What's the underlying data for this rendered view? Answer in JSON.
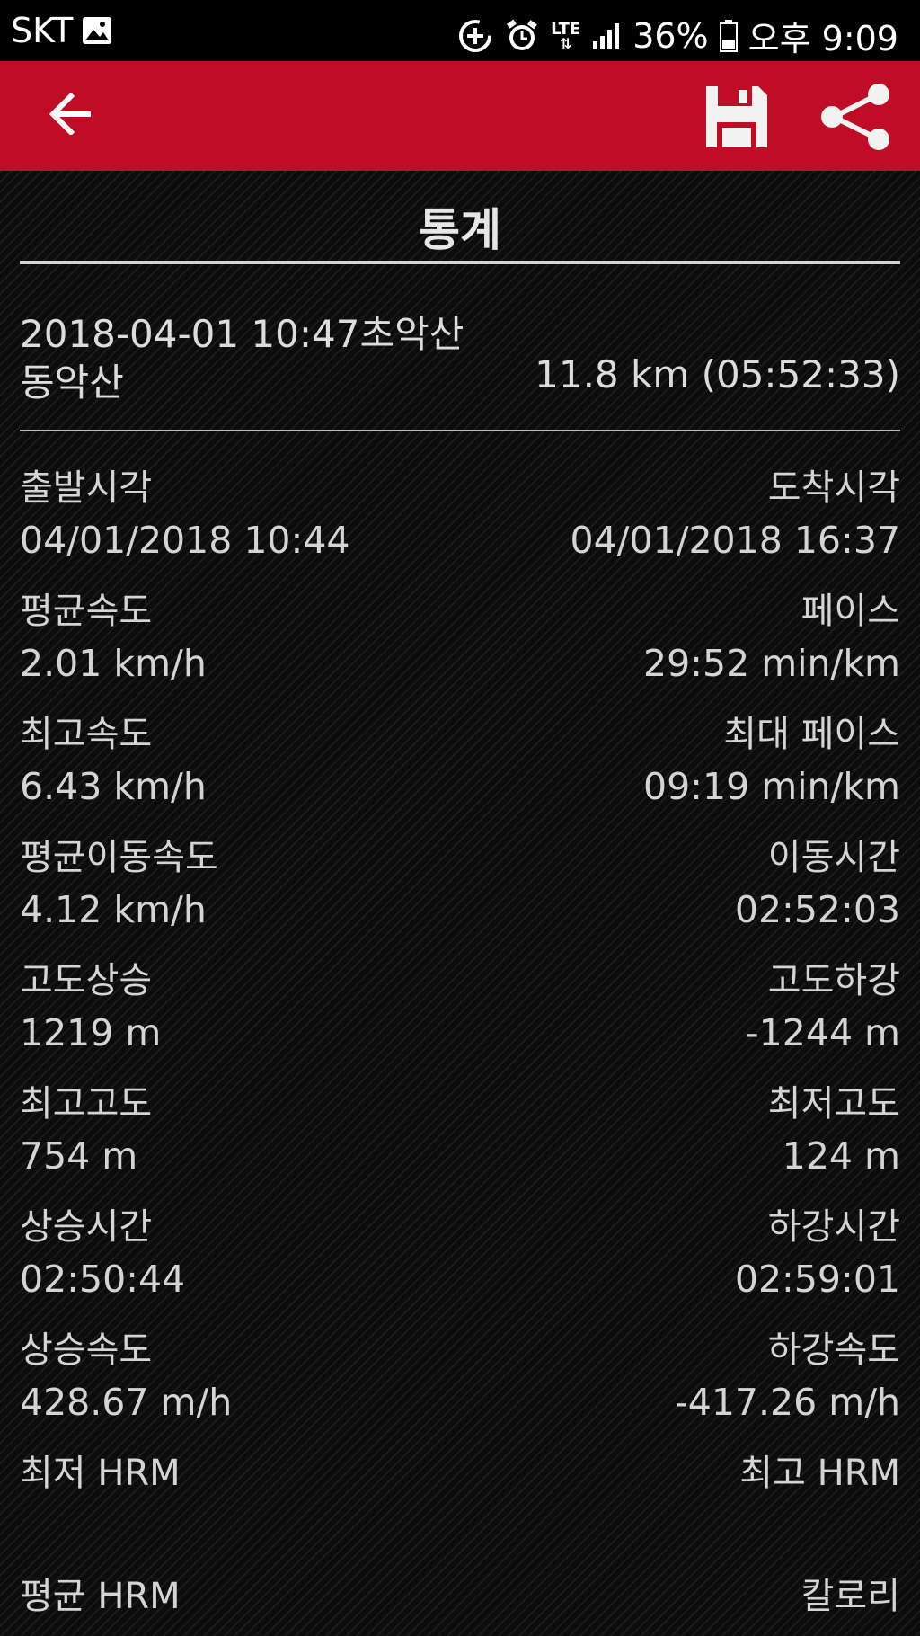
{
  "status_bar": {
    "carrier": "SKT",
    "network": "LTE",
    "battery": "36%",
    "time": "오후 9:09"
  },
  "toolbar": {
    "icons": [
      "back-arrow-icon",
      "save-floppy-icon",
      "share-icon"
    ]
  },
  "page": {
    "title": "통계"
  },
  "track": {
    "line1": "2018-04-01 10:47초악산",
    "line2": "동악산",
    "summary": "11.8 km (05:52:33)"
  },
  "stats": {
    "depart": {
      "label": "출발시각",
      "value": "04/01/2018 10:44"
    },
    "arrive": {
      "label": "도착시각",
      "value": "04/01/2018 16:37"
    },
    "avg_speed": {
      "label": "평균속도",
      "value": "2.01 km/h"
    },
    "pace": {
      "label": "페이스",
      "value": "29:52 min/km"
    },
    "max_speed": {
      "label": "최고속도",
      "value": "6.43 km/h"
    },
    "max_pace": {
      "label": "최대 페이스",
      "value": "09:19 min/km"
    },
    "avg_moving_speed": {
      "label": "평균이동속도",
      "value": "4.12 km/h"
    },
    "moving_time": {
      "label": "이동시간",
      "value": "02:52:03"
    },
    "ascent": {
      "label": "고도상승",
      "value": "1219 m"
    },
    "descent": {
      "label": "고도하강",
      "value": "-1244 m"
    },
    "max_alt": {
      "label": "최고고도",
      "value": "754 m"
    },
    "min_alt": {
      "label": "최저고도",
      "value": "124 m"
    },
    "ascent_time": {
      "label": "상승시간",
      "value": "02:50:44"
    },
    "descent_time": {
      "label": "하강시간",
      "value": "02:59:01"
    },
    "ascent_speed": {
      "label": "상승속도",
      "value": "428.67 m/h"
    },
    "descent_speed": {
      "label": "하강속도",
      "value": "-417.26 m/h"
    },
    "min_hrm": {
      "label": "최저 HRM",
      "value": ""
    },
    "max_hrm": {
      "label": "최고 HRM",
      "value": ""
    },
    "avg_hrm": {
      "label": "평균 HRM",
      "value": ""
    },
    "calories": {
      "label": "칼로리",
      "value": ""
    }
  },
  "colors": {
    "toolbar": "#c00d26",
    "background": "#111111",
    "text": "#d4d4d4"
  }
}
